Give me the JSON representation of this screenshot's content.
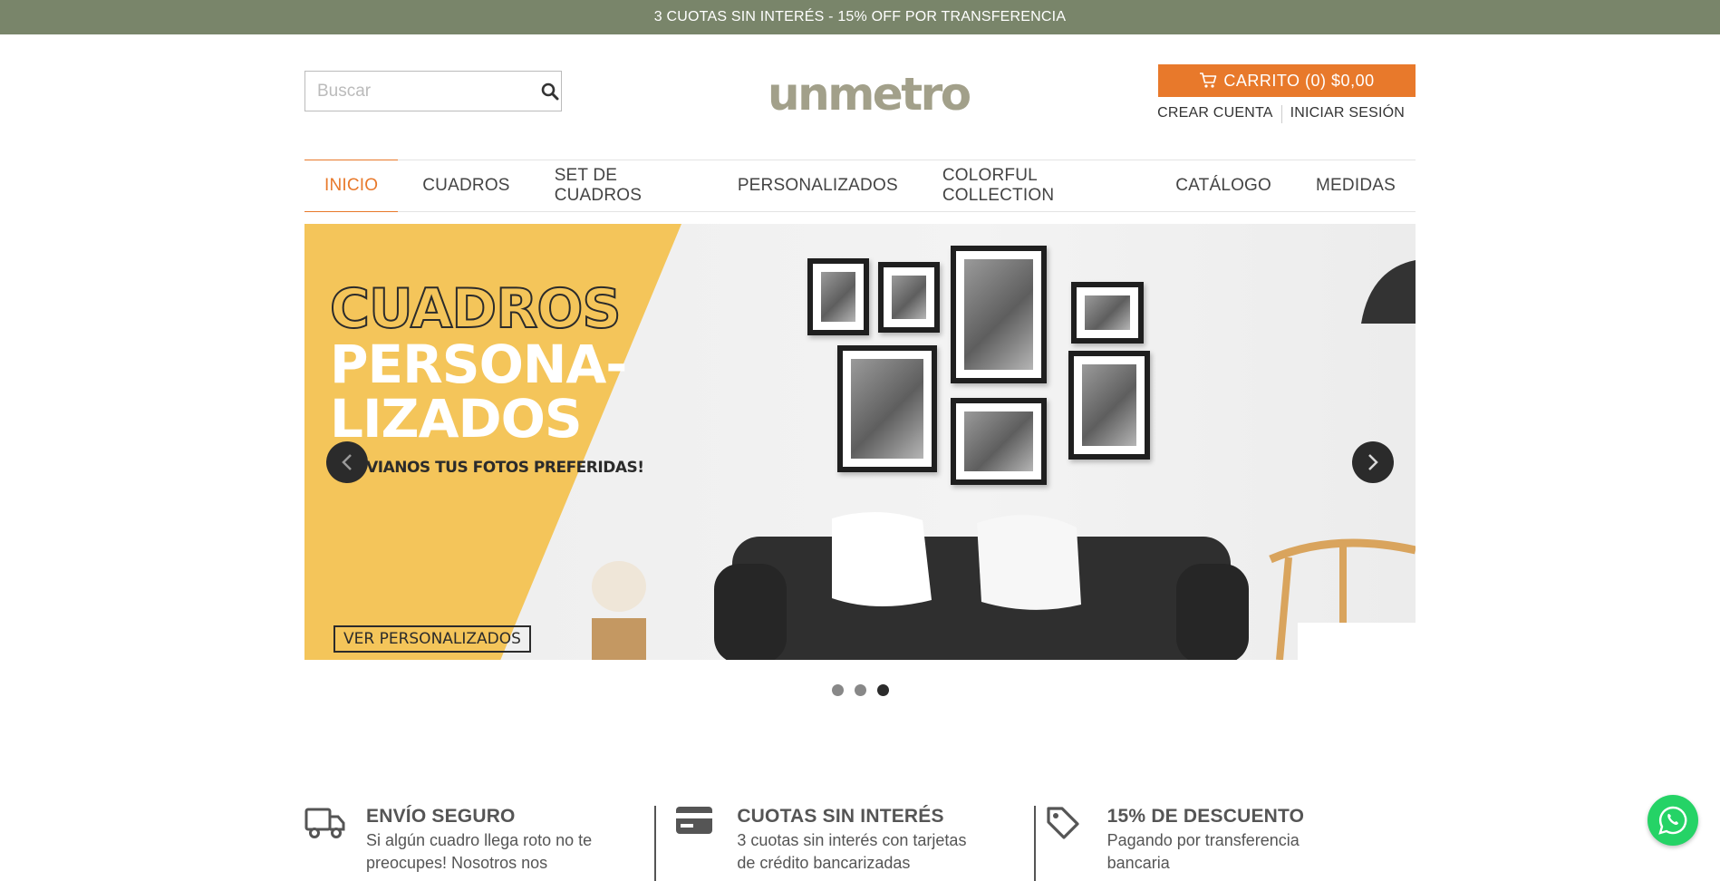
{
  "topbar": {
    "text": "3 CUOTAS SIN INTERÉS - 15% OFF POR TRANSFERENCIA"
  },
  "header": {
    "search_placeholder": "Buscar",
    "logo_text": "unmetro",
    "cart_label": "CARRITO (0) $0,00",
    "create_account": "CREAR CUENTA",
    "login": "INICIAR SESIÓN"
  },
  "nav": {
    "items": [
      {
        "label": "INICIO",
        "active": true
      },
      {
        "label": "CUADROS"
      },
      {
        "label": "SET DE CUADROS"
      },
      {
        "label": "PERSONALIZADOS"
      },
      {
        "label": "COLORFUL COLLECTION"
      },
      {
        "label": "CATÁLOGO"
      },
      {
        "label": "MEDIDAS"
      }
    ]
  },
  "slider": {
    "headline_1": "CUADROS",
    "headline_2": "PERSONA-",
    "headline_3": "LIZADOS",
    "subline": "¡ENVIANOS TUS FOTOS PREFERIDAS!",
    "cta": "VER PERSONALIZADOS",
    "slide_count": 3,
    "active_slide": 3
  },
  "features": [
    {
      "icon": "truck-icon",
      "title": "ENVÍO SEGURO",
      "desc_1": "Si algún cuadro llega roto no te",
      "desc_2": "preocupes! Nosotros nos"
    },
    {
      "icon": "credit-card-icon",
      "title": "CUOTAS SIN INTERÉS",
      "desc_1": "3 cuotas sin interés con tarjetas",
      "desc_2": "de crédito bancarizadas"
    },
    {
      "icon": "tag-icon",
      "title": "15% DE DESCUENTO",
      "desc_1": "Pagando por transferencia",
      "desc_2": "bancaria"
    }
  ],
  "colors": {
    "topbar_bg": "#79856a",
    "accent": "#e8792b",
    "logo": "#a2a08a",
    "banner_yellow": "#f4c55a",
    "whatsapp": "#25d366"
  }
}
